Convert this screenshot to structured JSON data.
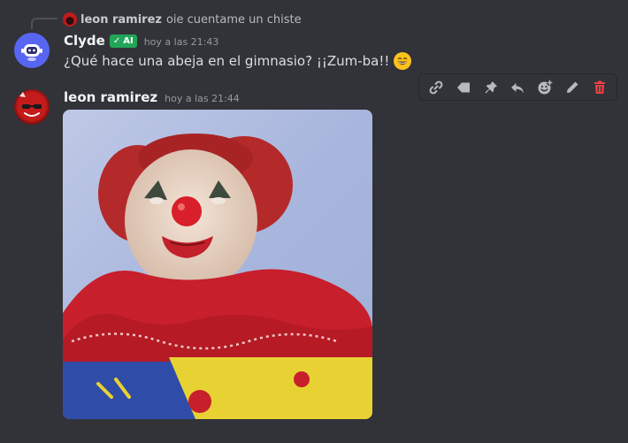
{
  "reply": {
    "author": "leon ramirez",
    "text": "oie cuentame un chiste"
  },
  "messages": [
    {
      "author": "Clyde",
      "badge": "AI",
      "timestamp": "hoy a las 21:43",
      "text": "¿Qué hace una abeja en el gimnasio? ¡¡Zum-ba!!",
      "emoji": "grinning-face-emoji"
    },
    {
      "author": "leon ramirez",
      "timestamp": "hoy a las 21:44",
      "attachment": "clown-photo"
    }
  ],
  "toolbar": {
    "actions": [
      "copy-link",
      "tag",
      "pin",
      "reply",
      "add-reaction",
      "edit",
      "delete"
    ]
  },
  "colors": {
    "background": "#313338",
    "clyde_avatar": "#5865f2",
    "ai_badge": "#23a559",
    "delete": "#f23f43"
  }
}
